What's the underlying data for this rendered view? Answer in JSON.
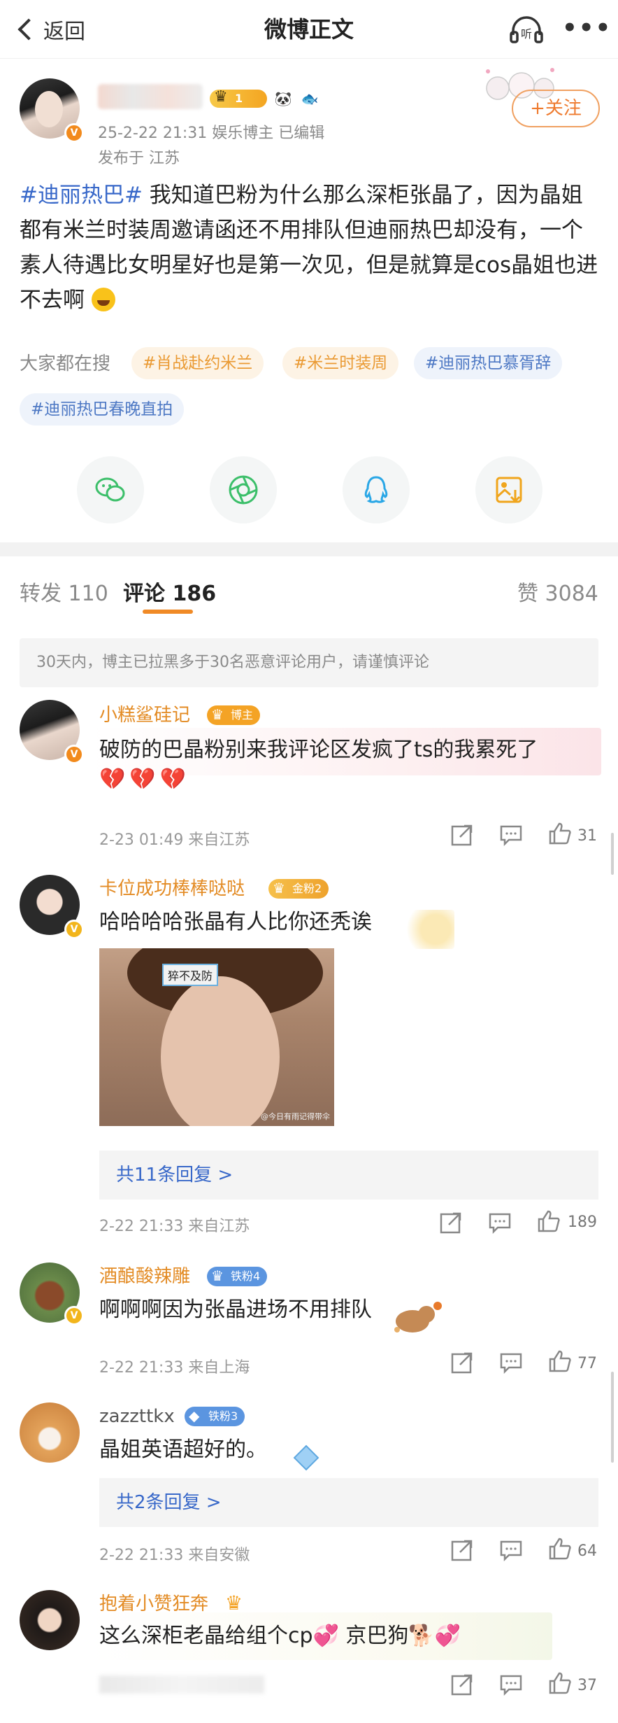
{
  "header": {
    "back_label": "返回",
    "title": "微博正文",
    "listen_label": "听"
  },
  "post": {
    "badge_level": "1",
    "meta": "25-2-22 21:31  娱乐博主  已编辑",
    "location": "发布于 江苏",
    "follow_label": "+关注",
    "text_tag": "#迪丽热巴#",
    "text_body": " 我知道巴粉为什么那么深柜张晶了，因为晶姐都有米兰时装周邀请函还不用排队但迪丽热巴却没有，一个素人待遇比女明星好也是第一次见，但是就算是cos晶姐也进不去啊"
  },
  "search": {
    "label": "大家都在搜",
    "chips": [
      "#肖战赴约米兰",
      "#米兰时装周",
      "#迪丽热巴慕胥辞",
      "#迪丽热巴春晚直拍"
    ]
  },
  "share_icons": [
    "wechat-icon",
    "moments-icon",
    "qq-icon",
    "save-image-icon"
  ],
  "tabs": {
    "repost": "转发 110",
    "comments": "评论 186",
    "likes": "赞 3084"
  },
  "notice": "30天内，博主已拉黑多于30名恶意评论用户，请谨慎评论",
  "comments": [
    {
      "name": "小糕鲨硅记",
      "badge": "博主",
      "text": "破防的巴晶粉别来我评论区发疯了ts的我累死了",
      "hearts": "💔💔💔",
      "meta": "2-23 01:49  来自江苏",
      "likes": "31"
    },
    {
      "name": "卡位成功棒棒哒哒",
      "badge": "金粉2",
      "text": "哈哈哈哈张晶有人比你还秃诶",
      "image_caption": "猝不及防",
      "image_watermark": "@今日有雨记得带伞",
      "replies": "共11条回复 >",
      "meta": "2-22 21:33  来自江苏",
      "likes": "189"
    },
    {
      "name": "酒酿酸辣雕",
      "badge": "铁粉4",
      "text": "啊啊啊因为张晶进场不用排队",
      "meta": "2-22 21:33  来自上海",
      "likes": "77"
    },
    {
      "name": "zazzttkx",
      "badge": "铁粉3",
      "text": "晶姐英语超好的。",
      "replies": "共2条回复 >",
      "meta": "2-22 21:33  来自安徽",
      "likes": "64"
    },
    {
      "name": "抱着小赞狂奔",
      "text": "这么深柜老晶给组个cp💞 京巴狗🐕💞",
      "likes": "37"
    }
  ]
}
